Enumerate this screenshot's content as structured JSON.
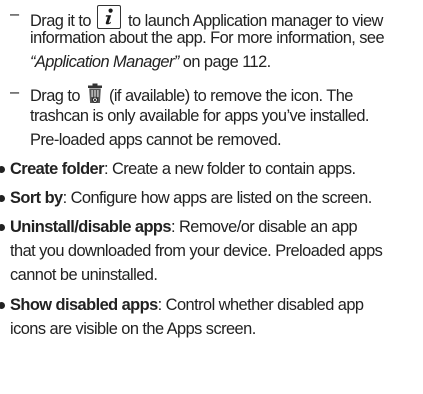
{
  "sub_items": [
    {
      "dash": "–",
      "line1_pre": "Drag it to",
      "icon": "info-icon",
      "line1_post": "to launch Application manager to view",
      "line2": "information about the app. For more information, see",
      "line3_ref": "“Application Manager”",
      "line3_post": " on page 112."
    },
    {
      "dash": "–",
      "line1_pre": "Drag to",
      "icon": "trashcan-icon",
      "line1_post": "(if available) to remove the icon. The",
      "line2": "trashcan is only available for apps you’ve installed.",
      "line3": "Pre-loaded apps cannot be removed."
    }
  ],
  "bullets": [
    {
      "term": "Create folder",
      "desc": ": Create a new folder to contain apps."
    },
    {
      "term": "Sort by",
      "desc": ": Configure how apps are listed on the screen."
    },
    {
      "term": "Uninstall/disable apps",
      "desc": ": Remove/or disable an app",
      "cont1": "that you downloaded from your device. Preloaded apps",
      "cont2": "cannot be uninstalled."
    },
    {
      "term": "Show disabled apps",
      "desc": ": Control whether disabled app",
      "cont1": "icons are visible on the Apps screen."
    }
  ]
}
